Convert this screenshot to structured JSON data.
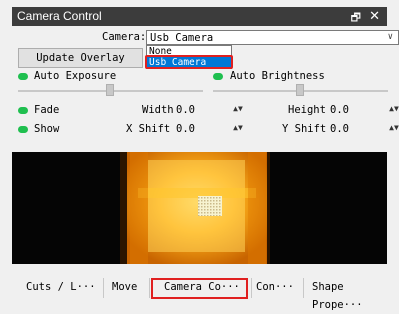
{
  "window": {
    "title": "Camera Control",
    "restore_glyph": "🗗",
    "close_glyph": "✕"
  },
  "camera": {
    "label": "Camera:",
    "selected": "Usb Camera",
    "options": [
      "None",
      "Usb Camera"
    ]
  },
  "buttons": {
    "update_overlay": "Update Overlay"
  },
  "controls": {
    "auto_exposure": "Auto Exposure",
    "auto_brightness": "Auto Brightness",
    "fade": "Fade",
    "show": "Show",
    "width_label": "Width",
    "width_value": "0.0",
    "height_label": "Height",
    "height_value": "0.0",
    "xshift_label": "X Shift",
    "xshift_value": "0.0",
    "yshift_label": "Y Shift",
    "yshift_value": "0.0",
    "toggle_color": "#1fbf4f"
  },
  "tabs": [
    "Cuts / L···",
    "Move",
    "Camera Co···",
    "Con···",
    "Shape Prope···"
  ],
  "icons": {
    "dropdown": "chevron-down-icon",
    "spin": "spin-arrows-icon"
  }
}
